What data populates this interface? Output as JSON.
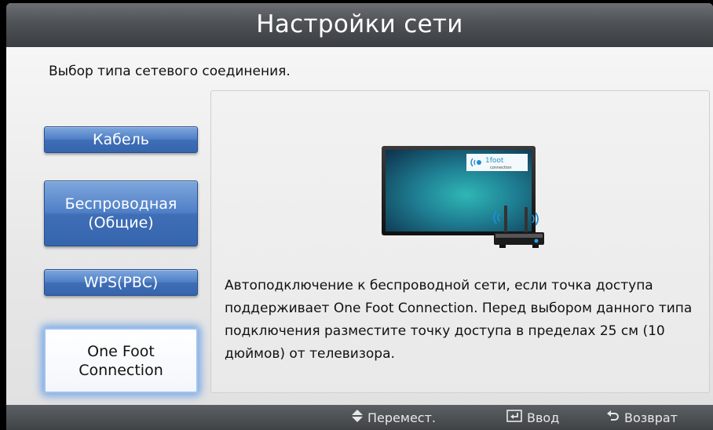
{
  "header": {
    "title": "Настройки сети"
  },
  "main": {
    "subtitle": "Выбор типа сетевого соединения.",
    "options": [
      {
        "label": "Кабель",
        "selected": false
      },
      {
        "label_line1": "Беспроводная",
        "label_line2": "(Общие)",
        "selected": false
      },
      {
        "label": "WPS(PBC)",
        "selected": false
      },
      {
        "label_line1": "One Foot",
        "label_line2": "Connection",
        "selected": true
      }
    ],
    "illustration": {
      "logo_text": "1foot",
      "logo_subtext": "connection"
    },
    "description": "Автоподключение к беспроводной сети, если точка доступа поддерживает One Foot Connection. Перед выбором данного типа подключения разместите точку доступа в пределах 25 см (10 дюймов) от телевизора."
  },
  "footer": {
    "hints": [
      {
        "icon": "up-down-arrow-icon",
        "label": "Перемест."
      },
      {
        "icon": "enter-icon",
        "label": "Ввод"
      },
      {
        "icon": "return-icon",
        "label": "Возврат"
      }
    ]
  },
  "colors": {
    "button_blue": "#4f7fc7",
    "selected_glow": "#5a96e6",
    "header_gray": "#4e5155"
  }
}
